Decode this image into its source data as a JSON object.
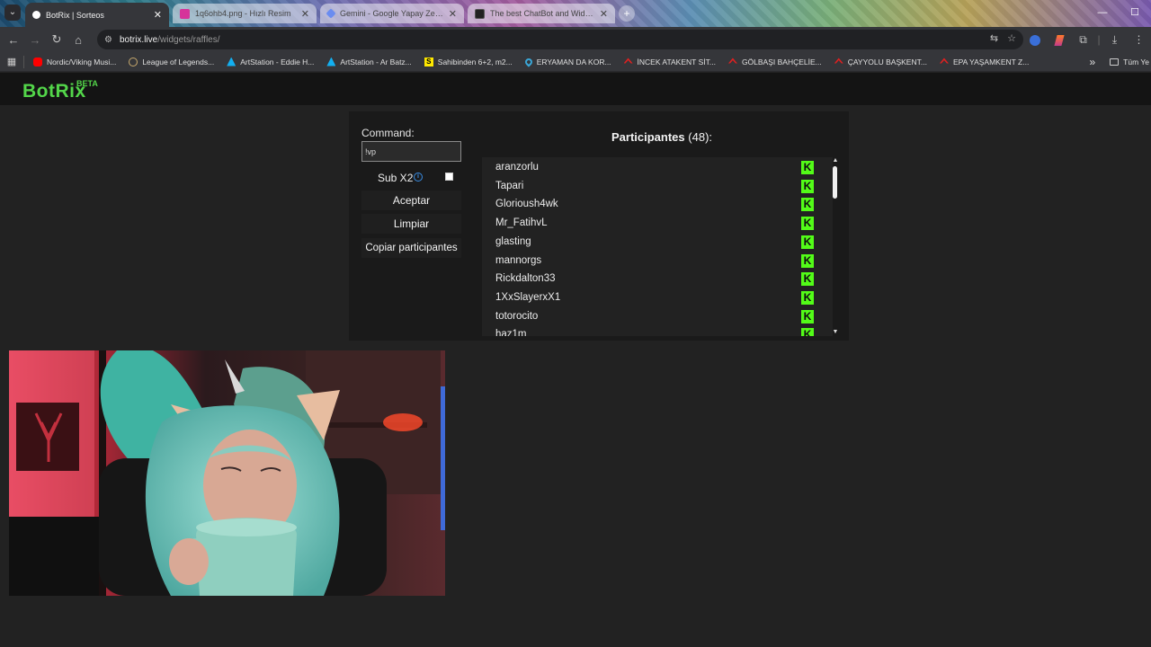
{
  "browser": {
    "tabs": [
      {
        "title": "BotRix | Sorteos",
        "active": true,
        "fav_color": "#ffffff"
      },
      {
        "title": "1q6ohb4.png - Hızlı Resim",
        "active": false,
        "fav_color": "#d6339a"
      },
      {
        "title": "Gemini - Google Yapay Zeka'yı",
        "active": false,
        "fav_color": "#6a8cf0"
      },
      {
        "title": "The best ChatBot and Widgets",
        "active": false,
        "fav_color": "#222222"
      }
    ],
    "url_host": "botrix.live",
    "url_path": "/widgets/raffles/",
    "bookmarks": [
      {
        "label": "Nordic/Viking Musi...",
        "color": "#ff0000"
      },
      {
        "label": "League of Legends...",
        "color": "#c8aa6e"
      },
      {
        "label": "ArtStation - Eddie H...",
        "color": "#13aff0"
      },
      {
        "label": "ArtStation - Ar Batz...",
        "color": "#13aff0"
      },
      {
        "label": "Sahibinden 6+2, m2...",
        "color": "#ffe800"
      },
      {
        "label": "ERYAMAN DA KOR...",
        "color": "#3aa7d8"
      },
      {
        "label": "İNCEK ATAKENT SİT...",
        "color": "#e02020"
      },
      {
        "label": "GÖLBAŞI BAHÇELİE...",
        "color": "#e02020"
      },
      {
        "label": "ÇAYYOLU BAŞKENT...",
        "color": "#e02020"
      },
      {
        "label": "EPA YAŞAMKENT Z...",
        "color": "#e02020"
      }
    ],
    "bookmarks_more": "»",
    "all_bookmarks": "Tüm Ye"
  },
  "site": {
    "logo": "BotRix",
    "logo_badge": "BETA"
  },
  "raffle": {
    "command_label": "Command:",
    "command_value": "!vp",
    "sub_label": "Sub X2",
    "sub_checked": false,
    "accept_label": "Aceptar",
    "clear_label": "Limpiar",
    "copy_label": "Copiar participantes",
    "participants_title": "Participantes",
    "participants_count": "(48):",
    "participants": [
      "aranzorlu",
      "Tapari",
      "Glorioush4wk",
      "Mr_FatihvL",
      "glasting",
      "mannorgs",
      "Rickdalton33",
      "1XxSlayerxX1",
      "totorocito",
      "haz1m"
    ],
    "kick_glyph": "K",
    "accent_color": "#53fc18"
  }
}
